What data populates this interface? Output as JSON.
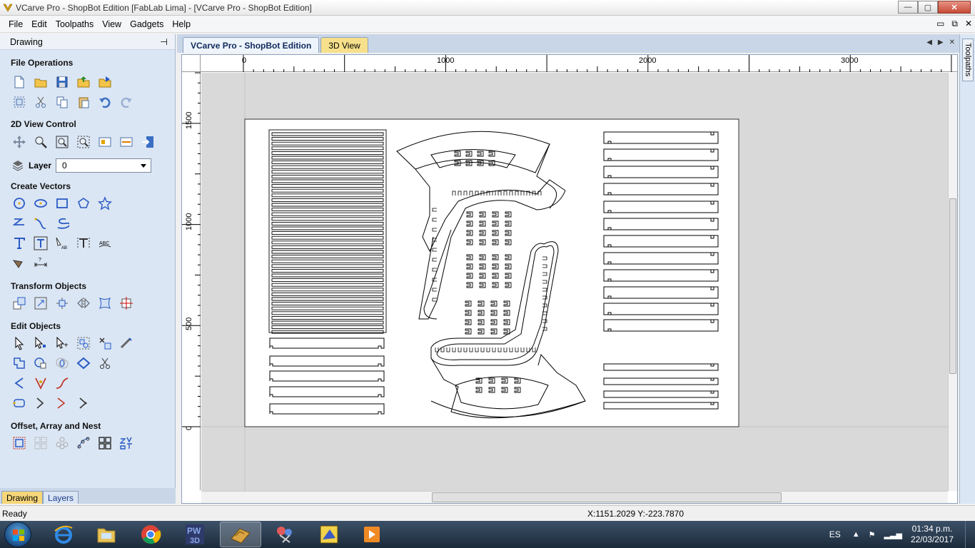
{
  "window": {
    "title": "VCarve Pro - ShopBot Edition [FabLab Lima] - [VCarve Pro - ShopBot Edition]",
    "buttons": {
      "minimize": "—",
      "maximize": "▢",
      "close": "✕"
    }
  },
  "menu": {
    "items": [
      "File",
      "Edit",
      "Toolpaths",
      "View",
      "Gadgets",
      "Help"
    ],
    "mdi_controls": [
      "▭",
      "⧉",
      "✕"
    ]
  },
  "left_panel": {
    "header": "Drawing",
    "pin": "⊣",
    "sections": {
      "file_operations": "File Operations",
      "view_control": "2D View Control",
      "create_vectors": "Create Vectors",
      "transform_objects": "Transform Objects",
      "edit_objects": "Edit Objects",
      "offset_array_nest": "Offset, Array and Nest"
    },
    "layer": {
      "label": "Layer",
      "value": "0"
    }
  },
  "bottom_tabs": [
    "Drawing",
    "Layers"
  ],
  "doc_tabs": [
    "VCarve Pro - ShopBot Edition",
    "3D View"
  ],
  "doc_nav": [
    "◀",
    "▶",
    "✕"
  ],
  "right_strip": {
    "label": "Toolpaths"
  },
  "rulers": {
    "horizontal": [
      "0",
      "1000",
      "2000",
      "3000"
    ],
    "vertical": [
      "1500",
      "1000",
      "500",
      "0"
    ]
  },
  "status": {
    "text": "Ready",
    "coords": "X:1151.2029 Y:-223.7870"
  },
  "taskbar": {
    "apps": [
      "internet-explorer",
      "file-explorer",
      "chrome",
      "pw3d",
      "vcarve",
      "scissors-app",
      "vectric-app",
      "media-player"
    ],
    "language": "ES",
    "time": "01:34 p.m.",
    "date": "22/03/2017"
  },
  "colors": {
    "panel_bg": "#dbe6f4",
    "canvas_bg": "#d9d9d9",
    "sheet": "#ffffff",
    "active_tab": "#f7d67a"
  }
}
